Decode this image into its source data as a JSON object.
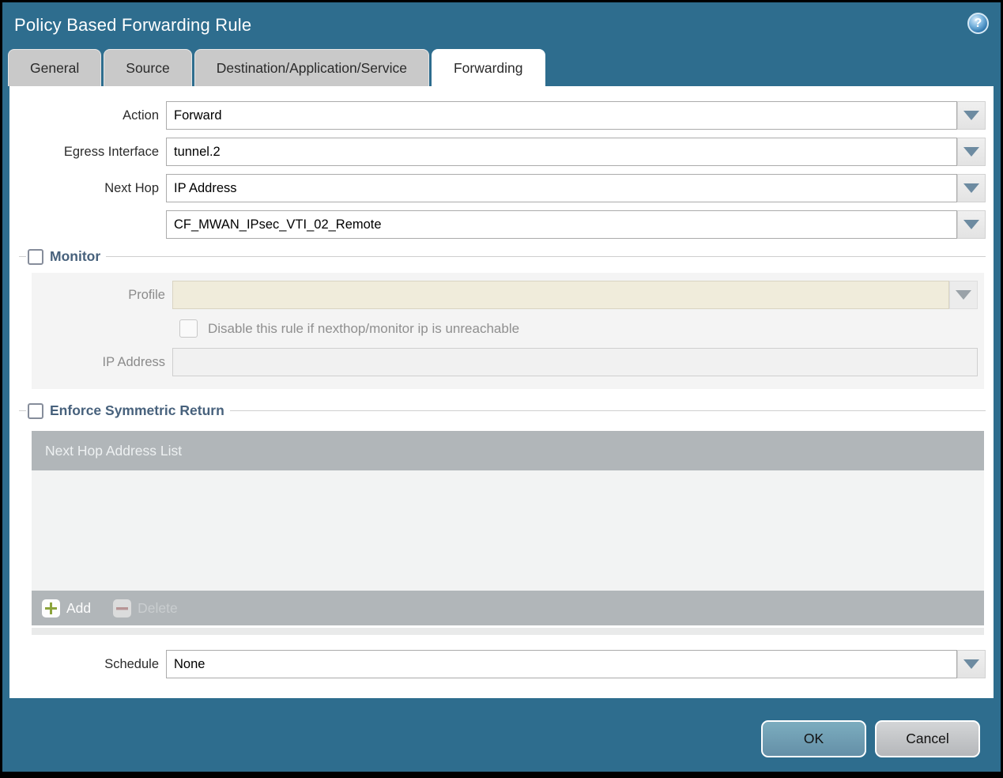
{
  "dialog": {
    "title": "Policy Based Forwarding Rule"
  },
  "tabs": [
    {
      "label": "General",
      "active": false
    },
    {
      "label": "Source",
      "active": false
    },
    {
      "label": "Destination/Application/Service",
      "active": false
    },
    {
      "label": "Forwarding",
      "active": true
    }
  ],
  "form": {
    "action": {
      "label": "Action",
      "value": "Forward"
    },
    "egress_interface": {
      "label": "Egress Interface",
      "value": "tunnel.2"
    },
    "next_hop": {
      "label": "Next Hop",
      "value": "IP Address"
    },
    "next_hop_address": {
      "value": "CF_MWAN_IPsec_VTI_02_Remote"
    },
    "schedule": {
      "label": "Schedule",
      "value": "None"
    }
  },
  "monitor_section": {
    "title": "Monitor",
    "checked": false,
    "profile": {
      "label": "Profile",
      "value": ""
    },
    "disable_rule_checkbox": {
      "label": "Disable this rule if nexthop/monitor ip is unreachable",
      "checked": false
    },
    "ip_address": {
      "label": "IP Address",
      "value": ""
    }
  },
  "symmetric_return_section": {
    "title": "Enforce Symmetric Return",
    "checked": false,
    "table": {
      "header": "Next Hop Address List",
      "rows": []
    },
    "add_label": "Add",
    "delete_label": "Delete"
  },
  "footer": {
    "ok_label": "OK",
    "cancel_label": "Cancel"
  },
  "icons": {
    "help": "?",
    "add": "plus-icon",
    "delete": "minus-icon",
    "dropdown": "chevron-down-icon"
  },
  "colors": {
    "frame_teal": "#2e6d8e",
    "tab_inactive": "#c9c9c9",
    "disabled_field_beige": "#f0ecdb",
    "panel_gray": "#f4f4f4",
    "table_header_gray": "#b1b6b9",
    "add_plus_green": "#8ca43c",
    "delete_minus_red": "#b98f8f",
    "ok_button": "#6ea3b6",
    "cancel_button": "#c6c8ca",
    "section_title": "#47617c"
  }
}
